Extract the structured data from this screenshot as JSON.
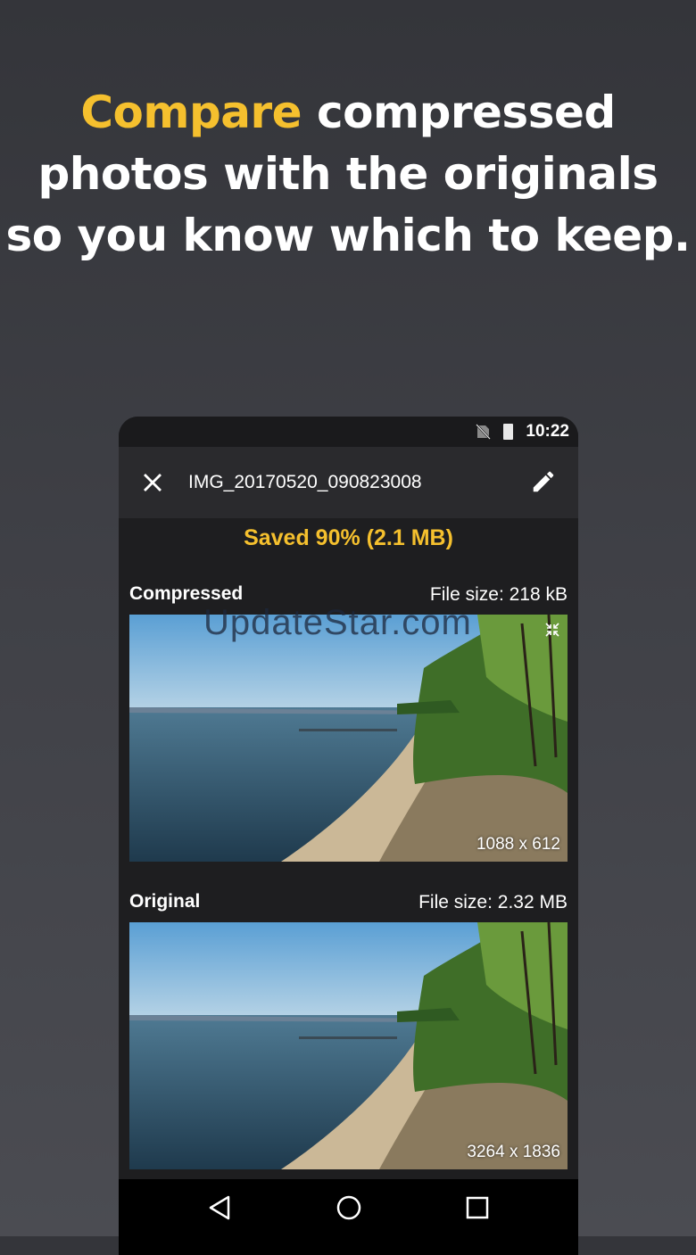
{
  "headline": {
    "accent": "Compare",
    "line1_rest": " compressed",
    "line2": "photos with the originals",
    "line3": "so you know which to keep."
  },
  "status_bar": {
    "time": "10:22"
  },
  "app_bar": {
    "title": "IMG_20170520_090823008"
  },
  "saved_text": "Saved 90% (2.1 MB)",
  "compressed": {
    "label": "Compressed",
    "file_size": "File size: 218 kB",
    "dimensions": "1088 x 612"
  },
  "original": {
    "label": "Original",
    "file_size": "File size: 2.32 MB",
    "dimensions": "3264 x 1836"
  },
  "watermark": "UpdateStar.com",
  "icons": {
    "close": "close-icon",
    "edit": "pencil-icon",
    "compress": "compress-arrows-icon",
    "back": "nav-back-icon",
    "home": "nav-home-icon",
    "recents": "nav-recents-icon"
  },
  "colors": {
    "accent": "#f5c02e",
    "app_bg": "#1e1e20",
    "app_bar": "#2a2a2d"
  }
}
